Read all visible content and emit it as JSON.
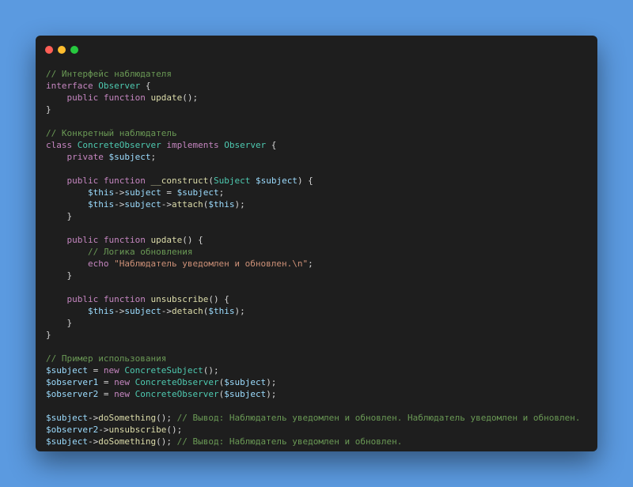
{
  "window": {
    "controls": {
      "close_color": "#ff5f56",
      "minimize_color": "#ffbd2e",
      "maximize_color": "#27c93f"
    }
  },
  "code": {
    "language": "php",
    "lines": [
      [
        {
          "t": "// Интерфейс наблюдателя",
          "c": "cmt"
        }
      ],
      [
        {
          "t": "interface",
          "c": "kw"
        },
        {
          "t": " ",
          "c": "pun"
        },
        {
          "t": "Observer",
          "c": "cls"
        },
        {
          "t": " {",
          "c": "pun"
        }
      ],
      [
        {
          "t": "    ",
          "c": "pun"
        },
        {
          "t": "public",
          "c": "kw"
        },
        {
          "t": " ",
          "c": "pun"
        },
        {
          "t": "function",
          "c": "kw"
        },
        {
          "t": " ",
          "c": "pun"
        },
        {
          "t": "update",
          "c": "fn"
        },
        {
          "t": "();",
          "c": "pun"
        }
      ],
      [
        {
          "t": "}",
          "c": "pun"
        }
      ],
      [],
      [
        {
          "t": "// Конкретный наблюдатель",
          "c": "cmt"
        }
      ],
      [
        {
          "t": "class",
          "c": "kw"
        },
        {
          "t": " ",
          "c": "pun"
        },
        {
          "t": "ConcreteObserver",
          "c": "cls"
        },
        {
          "t": " ",
          "c": "pun"
        },
        {
          "t": "implements",
          "c": "kw"
        },
        {
          "t": " ",
          "c": "pun"
        },
        {
          "t": "Observer",
          "c": "cls"
        },
        {
          "t": " {",
          "c": "pun"
        }
      ],
      [
        {
          "t": "    ",
          "c": "pun"
        },
        {
          "t": "private",
          "c": "kw"
        },
        {
          "t": " ",
          "c": "pun"
        },
        {
          "t": "$subject",
          "c": "var"
        },
        {
          "t": ";",
          "c": "pun"
        }
      ],
      [],
      [
        {
          "t": "    ",
          "c": "pun"
        },
        {
          "t": "public",
          "c": "kw"
        },
        {
          "t": " ",
          "c": "pun"
        },
        {
          "t": "function",
          "c": "kw"
        },
        {
          "t": " ",
          "c": "pun"
        },
        {
          "t": "__construct",
          "c": "fn"
        },
        {
          "t": "(",
          "c": "pun"
        },
        {
          "t": "Subject",
          "c": "cls"
        },
        {
          "t": " ",
          "c": "pun"
        },
        {
          "t": "$subject",
          "c": "var"
        },
        {
          "t": ") {",
          "c": "pun"
        }
      ],
      [
        {
          "t": "        ",
          "c": "pun"
        },
        {
          "t": "$this",
          "c": "var"
        },
        {
          "t": "->",
          "c": "pun"
        },
        {
          "t": "subject",
          "c": "var"
        },
        {
          "t": " = ",
          "c": "pun"
        },
        {
          "t": "$subject",
          "c": "var"
        },
        {
          "t": ";",
          "c": "pun"
        }
      ],
      [
        {
          "t": "        ",
          "c": "pun"
        },
        {
          "t": "$this",
          "c": "var"
        },
        {
          "t": "->",
          "c": "pun"
        },
        {
          "t": "subject",
          "c": "var"
        },
        {
          "t": "->",
          "c": "pun"
        },
        {
          "t": "attach",
          "c": "fn"
        },
        {
          "t": "(",
          "c": "pun"
        },
        {
          "t": "$this",
          "c": "var"
        },
        {
          "t": ");",
          "c": "pun"
        }
      ],
      [
        {
          "t": "    }",
          "c": "pun"
        }
      ],
      [],
      [
        {
          "t": "    ",
          "c": "pun"
        },
        {
          "t": "public",
          "c": "kw"
        },
        {
          "t": " ",
          "c": "pun"
        },
        {
          "t": "function",
          "c": "kw"
        },
        {
          "t": " ",
          "c": "pun"
        },
        {
          "t": "update",
          "c": "fn"
        },
        {
          "t": "() {",
          "c": "pun"
        }
      ],
      [
        {
          "t": "        ",
          "c": "pun"
        },
        {
          "t": "// Логика обновления",
          "c": "cmt"
        }
      ],
      [
        {
          "t": "        ",
          "c": "pun"
        },
        {
          "t": "echo",
          "c": "kw"
        },
        {
          "t": " ",
          "c": "pun"
        },
        {
          "t": "\"Наблюдатель уведомлен и обновлен.\\n\"",
          "c": "str"
        },
        {
          "t": ";",
          "c": "pun"
        }
      ],
      [
        {
          "t": "    }",
          "c": "pun"
        }
      ],
      [],
      [
        {
          "t": "    ",
          "c": "pun"
        },
        {
          "t": "public",
          "c": "kw"
        },
        {
          "t": " ",
          "c": "pun"
        },
        {
          "t": "function",
          "c": "kw"
        },
        {
          "t": " ",
          "c": "pun"
        },
        {
          "t": "unsubscribe",
          "c": "fn"
        },
        {
          "t": "() {",
          "c": "pun"
        }
      ],
      [
        {
          "t": "        ",
          "c": "pun"
        },
        {
          "t": "$this",
          "c": "var"
        },
        {
          "t": "->",
          "c": "pun"
        },
        {
          "t": "subject",
          "c": "var"
        },
        {
          "t": "->",
          "c": "pun"
        },
        {
          "t": "detach",
          "c": "fn"
        },
        {
          "t": "(",
          "c": "pun"
        },
        {
          "t": "$this",
          "c": "var"
        },
        {
          "t": ");",
          "c": "pun"
        }
      ],
      [
        {
          "t": "    }",
          "c": "pun"
        }
      ],
      [
        {
          "t": "}",
          "c": "pun"
        }
      ],
      [],
      [
        {
          "t": "// Пример использования",
          "c": "cmt"
        }
      ],
      [
        {
          "t": "$subject",
          "c": "var"
        },
        {
          "t": " = ",
          "c": "pun"
        },
        {
          "t": "new",
          "c": "kw"
        },
        {
          "t": " ",
          "c": "pun"
        },
        {
          "t": "ConcreteSubject",
          "c": "cls"
        },
        {
          "t": "();",
          "c": "pun"
        }
      ],
      [
        {
          "t": "$observer1",
          "c": "var"
        },
        {
          "t": " = ",
          "c": "pun"
        },
        {
          "t": "new",
          "c": "kw"
        },
        {
          "t": " ",
          "c": "pun"
        },
        {
          "t": "ConcreteObserver",
          "c": "cls"
        },
        {
          "t": "(",
          "c": "pun"
        },
        {
          "t": "$subject",
          "c": "var"
        },
        {
          "t": ");",
          "c": "pun"
        }
      ],
      [
        {
          "t": "$observer2",
          "c": "var"
        },
        {
          "t": " = ",
          "c": "pun"
        },
        {
          "t": "new",
          "c": "kw"
        },
        {
          "t": " ",
          "c": "pun"
        },
        {
          "t": "ConcreteObserver",
          "c": "cls"
        },
        {
          "t": "(",
          "c": "pun"
        },
        {
          "t": "$subject",
          "c": "var"
        },
        {
          "t": ");",
          "c": "pun"
        }
      ],
      [],
      [
        {
          "t": "$subject",
          "c": "var"
        },
        {
          "t": "->",
          "c": "pun"
        },
        {
          "t": "doSomething",
          "c": "fn"
        },
        {
          "t": "(); ",
          "c": "pun"
        },
        {
          "t": "// Вывод: Наблюдатель уведомлен и обновлен. Наблюдатель уведомлен и обновлен.",
          "c": "cmt"
        }
      ],
      [
        {
          "t": "$observer2",
          "c": "var"
        },
        {
          "t": "->",
          "c": "pun"
        },
        {
          "t": "unsubscribe",
          "c": "fn"
        },
        {
          "t": "();",
          "c": "pun"
        }
      ],
      [
        {
          "t": "$subject",
          "c": "var"
        },
        {
          "t": "->",
          "c": "pun"
        },
        {
          "t": "doSomething",
          "c": "fn"
        },
        {
          "t": "(); ",
          "c": "pun"
        },
        {
          "t": "// Вывод: Наблюдатель уведомлен и обновлен.",
          "c": "cmt"
        }
      ]
    ]
  }
}
